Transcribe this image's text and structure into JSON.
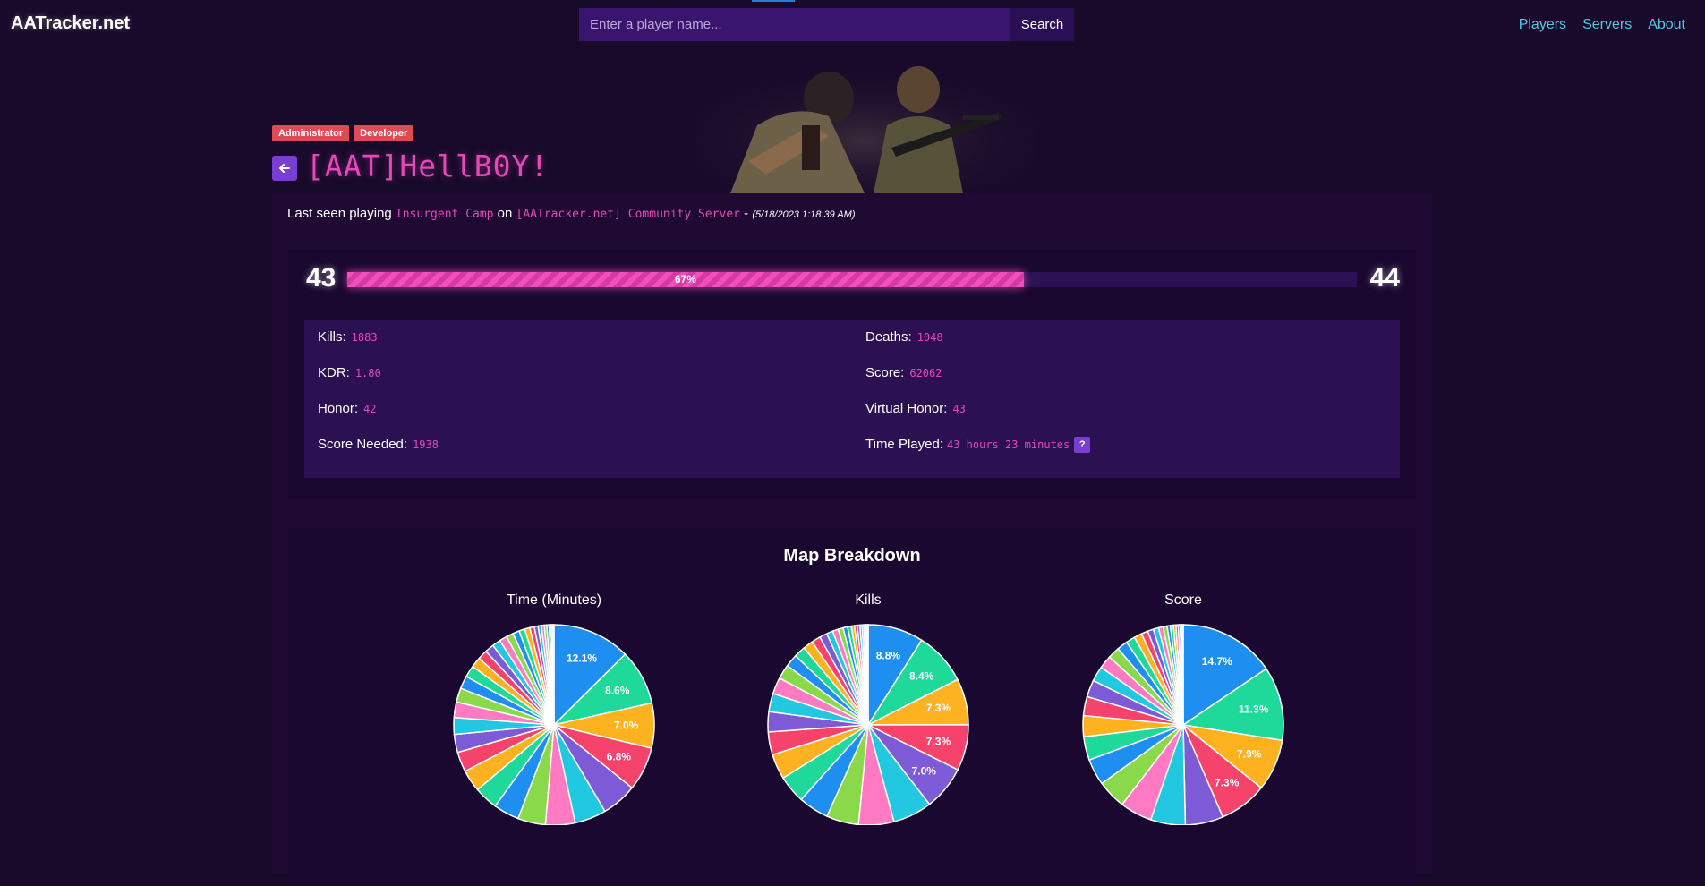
{
  "header": {
    "logo": "AATracker.net",
    "search_placeholder": "Enter a player name...",
    "search_button": "Search",
    "nav": [
      "Players",
      "Servers",
      "About"
    ]
  },
  "player": {
    "badges": [
      "Administrator",
      "Developer"
    ],
    "name": "[AAT]HellB0Y!",
    "back_icon": "arrow-left-icon"
  },
  "last_seen": {
    "prefix": "Last seen playing",
    "map": "Insurgent Camp",
    "on": "on",
    "server": "[AATracker.net] Community Server",
    "dash": "-",
    "timestamp": "(5/18/2023 1:18:39 AM)"
  },
  "level": {
    "current": "43",
    "next": "44",
    "progress_pct": 67,
    "progress_label": "67%"
  },
  "stats": {
    "kills_label": "Kills:",
    "kills": "1883",
    "deaths_label": "Deaths:",
    "deaths": "1048",
    "kdr_label": "KDR:",
    "kdr": "1.80",
    "score_label": "Score:",
    "score": "62062",
    "honor_label": "Honor:",
    "honor": "42",
    "virtual_honor_label": "Virtual Honor:",
    "virtual_honor": "43",
    "score_needed_label": "Score Needed:",
    "score_needed": "1938",
    "time_played_label": "Time Played:",
    "time_played": "43 hours 23 minutes",
    "help_label": "?"
  },
  "map_breakdown": {
    "title": "Map Breakdown"
  },
  "colors": {
    "accent_pink": "#e548b8",
    "link_cyan": "#4ec9e8",
    "badge_red": "#e04a55",
    "button_purple": "#7a3fd0",
    "pie_palette": [
      "#1f8ef1",
      "#1ed99a",
      "#ffb21f",
      "#f5436b",
      "#7d5bd6"
    ]
  },
  "chart_data": [
    {
      "type": "pie",
      "title": "Time (Minutes)",
      "labeled_slices": [
        "12.1%",
        "8.6%",
        "7.0%",
        "6.8%"
      ],
      "values": [
        12.1,
        8.6,
        7.0,
        6.8,
        5.5,
        4.9,
        4.6,
        4.3,
        4.0,
        3.7,
        3.4,
        3.1,
        2.8,
        2.6,
        2.4,
        2.2,
        2.0,
        1.8,
        1.6,
        1.5,
        1.4,
        1.3,
        1.2,
        1.1,
        1.0,
        0.9,
        0.8,
        0.7,
        0.6,
        0.5,
        0.45,
        0.4,
        0.35,
        0.3,
        0.25,
        0.2
      ]
    },
    {
      "type": "pie",
      "title": "Kills",
      "labeled_slices": [
        "8.8%",
        "8.4%",
        "7.3%",
        "7.3%",
        "7.0%"
      ],
      "values": [
        8.8,
        8.4,
        7.3,
        7.3,
        7.0,
        6.2,
        5.6,
        5.1,
        4.8,
        4.4,
        4.0,
        3.6,
        3.2,
        2.9,
        2.6,
        2.3,
        2.0,
        1.8,
        1.6,
        1.4,
        1.2,
        1.0,
        0.9,
        0.8,
        0.7,
        0.6,
        0.5,
        0.45,
        0.4,
        0.35,
        0.3,
        0.25,
        0.2,
        0.2
      ]
    },
    {
      "type": "pie",
      "title": "Score",
      "labeled_slices": [
        "14.7%",
        "11.3%",
        "7.9%",
        "7.3%"
      ],
      "values": [
        14.7,
        11.3,
        7.9,
        7.3,
        5.8,
        5.3,
        4.9,
        4.4,
        4.0,
        3.6,
        3.2,
        2.9,
        2.6,
        2.3,
        2.0,
        1.8,
        1.6,
        1.4,
        1.2,
        1.0,
        0.9,
        0.8,
        0.7,
        0.6,
        0.5,
        0.45,
        0.4,
        0.35,
        0.3,
        0.25,
        0.2
      ]
    }
  ]
}
